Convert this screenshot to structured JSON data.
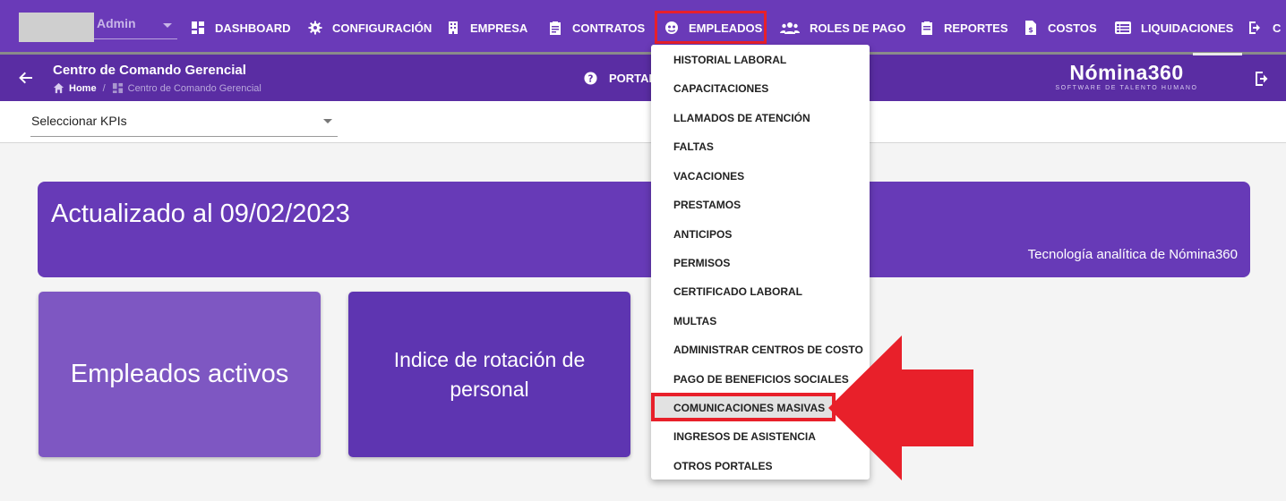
{
  "topnav": {
    "user_label": "Admin",
    "items": [
      {
        "label": "DASHBOARD",
        "icon": "dashboard-icon"
      },
      {
        "label": "CONFIGURACIÓN",
        "icon": "gear-icon"
      },
      {
        "label": "EMPRESA",
        "icon": "building-icon"
      },
      {
        "label": "CONTRATOS",
        "icon": "clipboard-icon"
      },
      {
        "label": "EMPLEADOS",
        "icon": "employees-icon"
      },
      {
        "label": "ROLES DE PAGO",
        "icon": "users-icon"
      },
      {
        "label": "REPORTES",
        "icon": "report-icon"
      },
      {
        "label": "COSTOS",
        "icon": "invoice-icon"
      },
      {
        "label": "LIQUIDACIONES",
        "icon": "list-icon"
      },
      {
        "label": "C",
        "icon": "logout-icon"
      }
    ],
    "highlight_color": "#e8202a"
  },
  "subbar": {
    "title": "Centro de Comando Gerencial",
    "breadcrumb_home": "Home",
    "breadcrumb_current": "Centro de Comando Gerencial",
    "portal_label": "PORTAL",
    "brand_name": "Nómina360",
    "brand_tagline": "SOFTWARE DE TALENTO HUMANO"
  },
  "kpi": {
    "select_label": "Seleccionar KPIs"
  },
  "banner": {
    "updated": "Actualizado al 09/02/2023",
    "tech": "Tecnología analítica de Nómina360"
  },
  "cards": [
    {
      "label": "Empleados activos"
    },
    {
      "label": "Indice de rotación de personal"
    }
  ],
  "dropdown": {
    "items": [
      "HISTORIAL LABORAL",
      "CAPACITACIONES",
      "LLAMADOS DE ATENCIÓN",
      "FALTAS",
      "VACACIONES",
      "PRESTAMOS",
      "ANTICIPOS",
      "PERMISOS",
      "CERTIFICADO LABORAL",
      "MULTAS",
      "ADMINISTRAR CENTROS DE COSTO",
      "PAGO DE BENEFICIOS SOCIALES",
      "COMUNICACIONES MASIVAS",
      "INGRESOS DE ASISTENCIA",
      "OTROS PORTALES"
    ],
    "selected": "COMUNICACIONES MASIVAS"
  },
  "colors": {
    "nav_bg": "#6a3ab8",
    "subbar_bg": "#5a2da3",
    "banner_bg": "#673ab7",
    "card1_bg": "#7e57c2",
    "card2_bg": "#5e35b1",
    "annotation_red": "#e8202a"
  }
}
